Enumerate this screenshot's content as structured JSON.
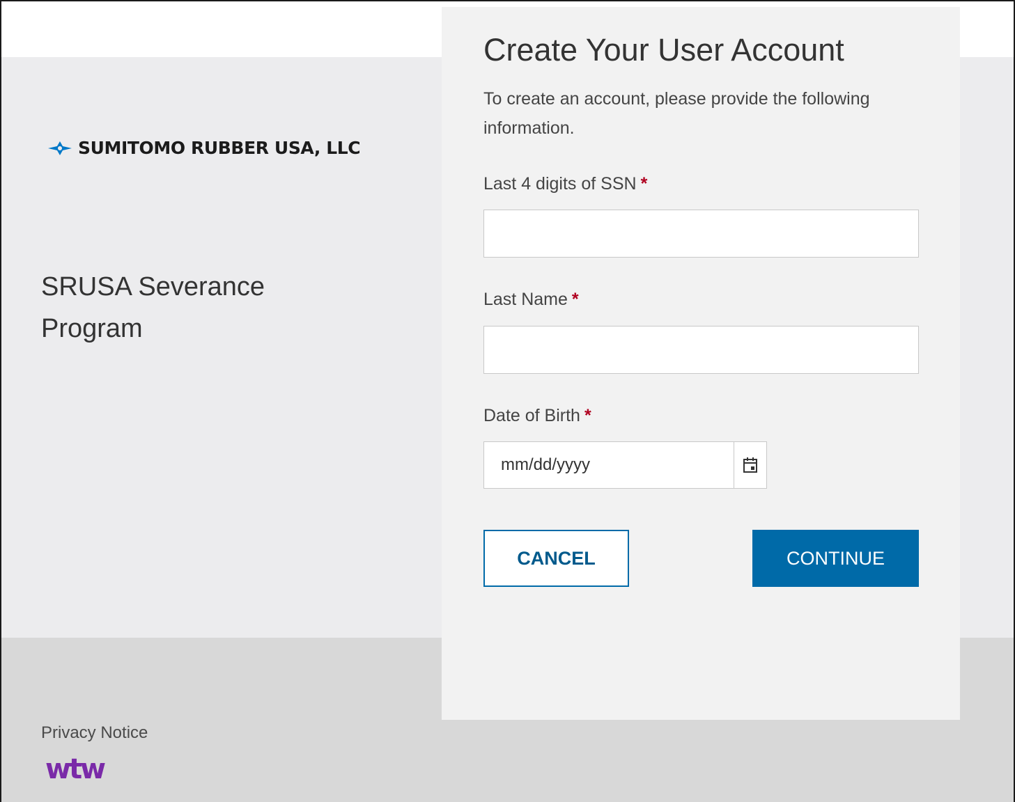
{
  "brand": {
    "company_name": "SUMITOMO RUBBER USA, LLC",
    "logo_icon": "diamond-star-icon",
    "logo_color": "#0078c8",
    "program_title": "SRUSA Severance Program"
  },
  "footer": {
    "privacy_label": "Privacy Notice",
    "wtw_logo_text": "wtw",
    "wtw_color": "#7a2aa8"
  },
  "form": {
    "title": "Create Your User Account",
    "description": "To create an account, please provide the following information.",
    "required_marker": "*",
    "ssn": {
      "label": "Last 4 digits of SSN",
      "value": "",
      "placeholder": ""
    },
    "last_name": {
      "label": "Last Name",
      "value": "",
      "placeholder": ""
    },
    "dob": {
      "label": "Date of Birth",
      "placeholder": "mm/dd/yyyy",
      "icon": "calendar-icon"
    },
    "cancel_label": "CANCEL",
    "continue_label": "CONTINUE",
    "accent_color": "#006aa8"
  }
}
